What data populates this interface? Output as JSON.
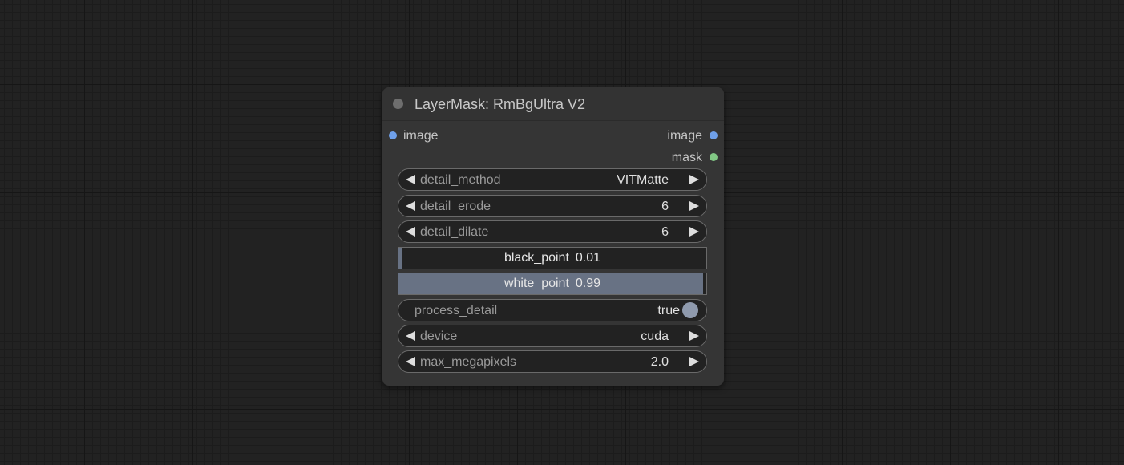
{
  "colors": {
    "canvas_bg": "#222222",
    "node_bg": "#353535",
    "widget_bg": "#222222",
    "slot_image": "#6fa0ea",
    "slot_mask": "#81c784",
    "slider_fill": "#687284",
    "toggle_knob": "#8f9aad"
  },
  "node": {
    "title": "LayerMask: RmBgUltra V2",
    "inputs": [
      {
        "label": "image",
        "type_icon": "image-slot-dot"
      }
    ],
    "outputs": [
      {
        "label": "image",
        "type_icon": "image-slot-dot"
      },
      {
        "label": "mask",
        "type_icon": "mask-slot-dot"
      }
    ],
    "widgets": {
      "detail_method": {
        "label": "detail_method",
        "value": "VITMatte"
      },
      "detail_erode": {
        "label": "detail_erode",
        "value": "6"
      },
      "detail_dilate": {
        "label": "detail_dilate",
        "value": "6"
      },
      "black_point": {
        "label": "black_point",
        "value": "0.01",
        "fill_fraction": 0.01
      },
      "white_point": {
        "label": "white_point",
        "value": "0.99",
        "fill_fraction": 0.99
      },
      "process_detail": {
        "label": "process_detail",
        "value": "true"
      },
      "device": {
        "label": "device",
        "value": "cuda"
      },
      "max_megapixels": {
        "label": "max_megapixels",
        "value": "2.0"
      }
    }
  }
}
